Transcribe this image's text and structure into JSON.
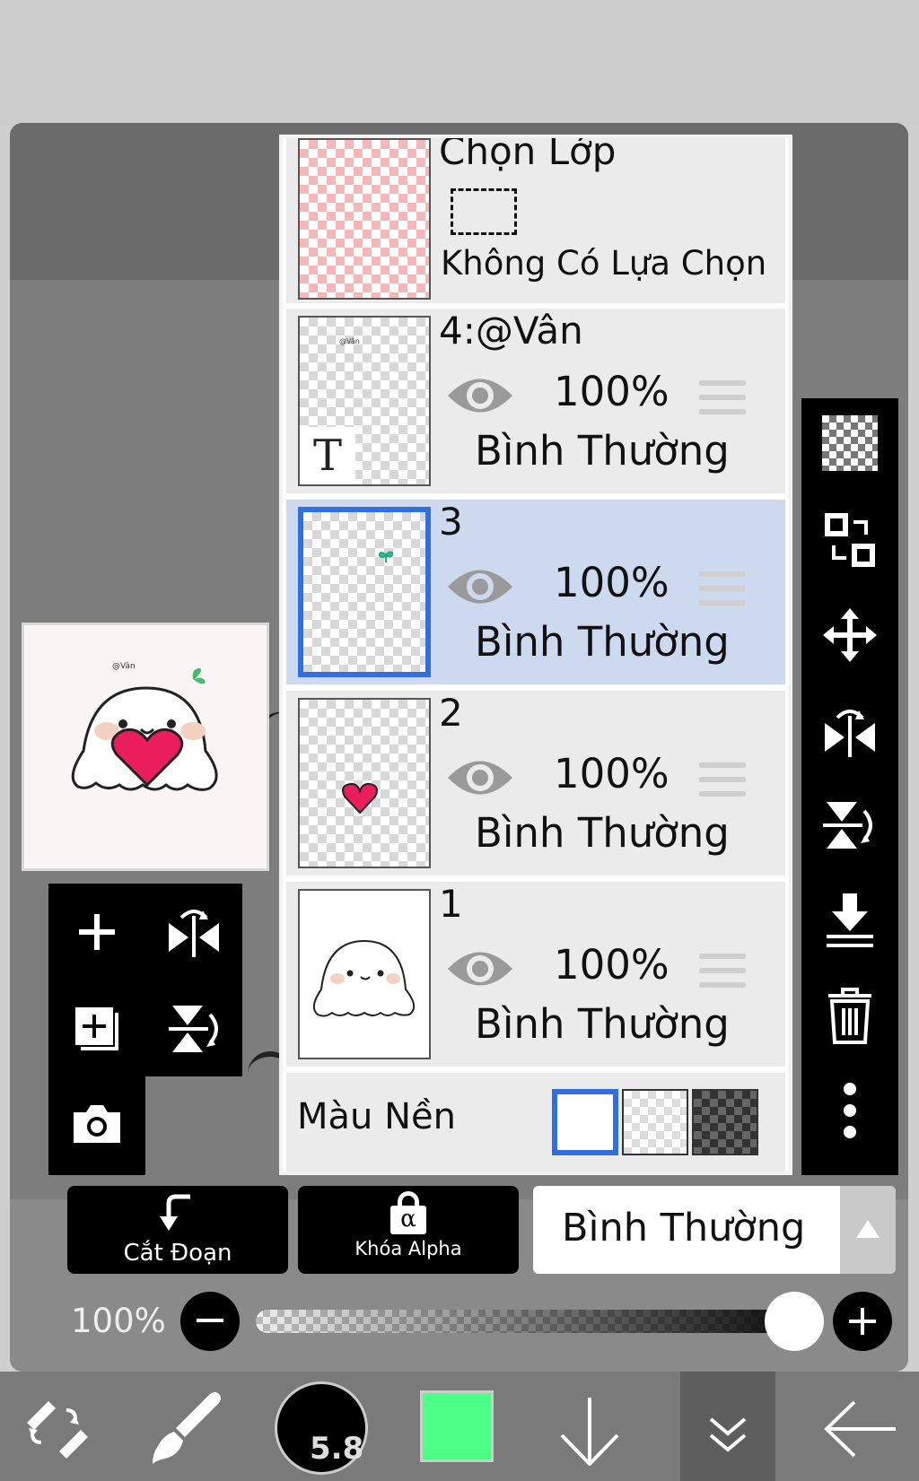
{
  "selection": {
    "title": "Chọn Lớp",
    "status": "Không Có Lựa Chọn"
  },
  "layers": [
    {
      "name": "4:@Vân",
      "opacity": "100%",
      "blend": "Bình Thường",
      "type_glyph": "T",
      "thumb_text": "@Vân"
    },
    {
      "name": "3",
      "opacity": "100%",
      "blend": "Bình Thường"
    },
    {
      "name": "2",
      "opacity": "100%",
      "blend": "Bình Thường"
    },
    {
      "name": "1",
      "opacity": "100%",
      "blend": "Bình Thường"
    }
  ],
  "background": {
    "label": "Màu Nền"
  },
  "canvas_preview": {
    "watermark": "@Vân"
  },
  "controls": {
    "clip_label": "Cắt Đoạn",
    "alpha_lock_label": "Khóa Alpha",
    "alpha_glyph": "α",
    "blend_mode": "Bình Thường",
    "opacity_value": "100%"
  },
  "brush": {
    "size": "5.8"
  },
  "colors": {
    "current_color": "#4cff87",
    "selected_layer_bg": "#cdd9ee",
    "selected_border": "#2f6fe0"
  },
  "icons": {
    "left": [
      "add-layer-icon",
      "flip-horizontal-icon",
      "add-layer-copy-icon",
      "flip-vertical-icon",
      "camera-icon"
    ],
    "right": [
      "transparency-icon",
      "swap-icon",
      "move-icon",
      "flip-horizontal-icon",
      "flip-vertical-icon",
      "merge-down-icon",
      "trash-icon",
      "more-icon"
    ],
    "nav": [
      "tool-switch-icon",
      "brush-icon",
      "brush-size-icon",
      "color-swatch-icon",
      "arrow-down-icon",
      "chevron-double-down-icon",
      "back-arrow-icon"
    ]
  }
}
